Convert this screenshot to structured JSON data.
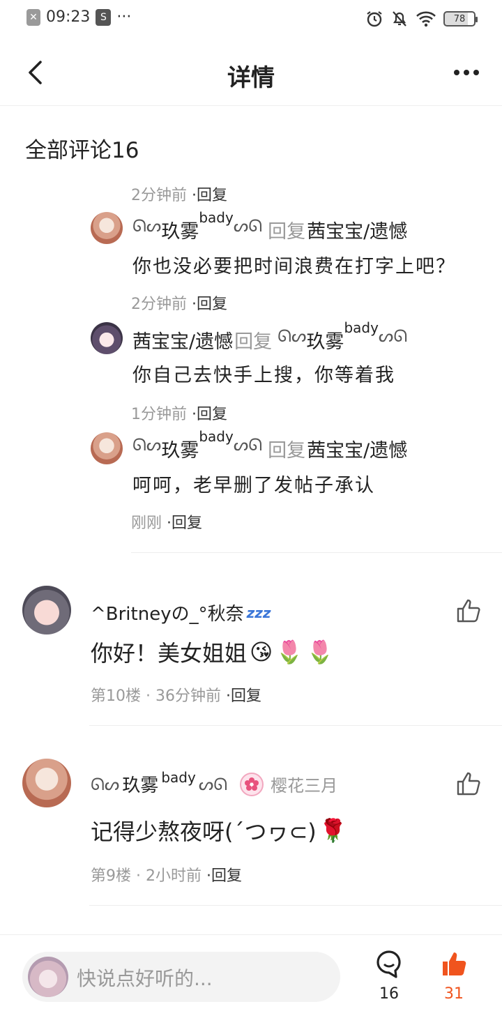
{
  "status_bar": {
    "time": "09:23",
    "battery": "78",
    "dots": "···"
  },
  "header": {
    "title": "详情"
  },
  "comments_section": {
    "title": "全部评论16"
  },
  "sub_replies": [
    {
      "meta_time": "2分钟前",
      "meta_reply": "·回复"
    },
    {
      "user": "玖雾",
      "user_sup": "bady",
      "reply_word": "回复",
      "target": "茜宝宝/遗憾",
      "text": "你也没必要把时间浪费在打字上吧？",
      "meta_time": "2分钟前",
      "meta_reply": "·回复"
    },
    {
      "user": "茜宝宝/遗憾",
      "reply_word": "回复",
      "target": "玖雾",
      "target_sup": "bady",
      "text": "你自己去快手上搜，你等着我",
      "meta_time": "1分钟前",
      "meta_reply": "·回复"
    },
    {
      "user": "玖雾",
      "user_sup": "bady",
      "reply_word": "回复",
      "target": "茜宝宝/遗憾",
      "text": "呵呵，老早删了发帖子承认",
      "meta_time": "刚刚",
      "meta_reply": "·回复"
    }
  ],
  "main_comments": [
    {
      "name": "^Britneyの_°秋奈",
      "name_emoji": "zzz",
      "text": "你好！美女姐姐",
      "emojis": [
        "😘",
        "🌷",
        "🌷"
      ],
      "floor": "第10楼",
      "time": "· 36分钟前",
      "reply": "·回复"
    },
    {
      "name": "玖雾",
      "name_sup": "bady",
      "badge": "樱花三月",
      "text": "记得少熬夜呀(´つヮ⊂)",
      "emojis": [
        "🌹"
      ],
      "floor": "第9楼",
      "time": "· 2小时前",
      "reply": "·回复"
    }
  ],
  "bottom_bar": {
    "placeholder": "快说点好听的...",
    "comment_count": "16",
    "like_count": "31"
  },
  "colors": {
    "accent_like": "#f0541e",
    "muted": "#999999",
    "text": "#222222"
  }
}
